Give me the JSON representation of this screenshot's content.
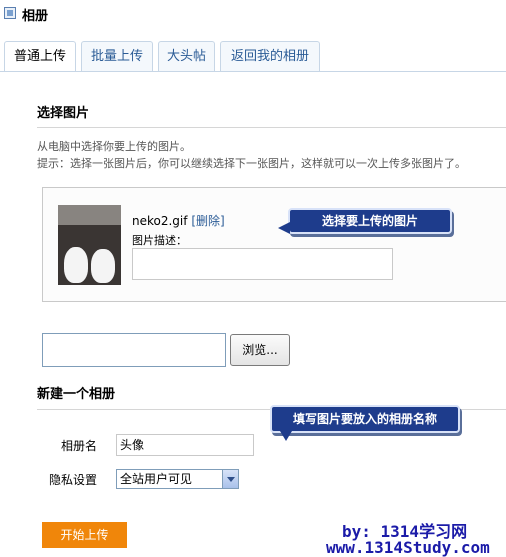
{
  "header": {
    "title": "相册"
  },
  "tabs": [
    {
      "label": "普通上传",
      "active": true
    },
    {
      "label": "批量上传",
      "active": false
    },
    {
      "label": "大头帖",
      "active": false
    },
    {
      "label": "返回我的相册",
      "active": false
    }
  ],
  "select_section": {
    "title": "选择图片",
    "hint1": "从电脑中选择你要上传的图片。",
    "hint2": "提示：选择一张图片后，你可以继续选择下一张图片，这样就可以一次上传多张图片了。"
  },
  "upload_item": {
    "filename": "neko2.gif",
    "delete_link": "[删除]",
    "desc_label": "图片描述："
  },
  "callouts": {
    "select": "选择要上传的图片",
    "album": "填写图片要放入的相册名称"
  },
  "file_row": {
    "browse_label": "浏览..."
  },
  "album_section": {
    "title": "新建一个相册",
    "name_label": "相册名",
    "name_value": "头像",
    "privacy_label": "隐私设置",
    "privacy_value": "全站用户可见"
  },
  "submit": {
    "label": "开始上传"
  },
  "watermark": {
    "line1": "by: 1314学习网",
    "line2": "www.1314Study.com"
  },
  "colors": {
    "accent_orange": "#f0860a",
    "callout_blue": "#1e3c8c",
    "link_blue": "#2a5b96"
  }
}
